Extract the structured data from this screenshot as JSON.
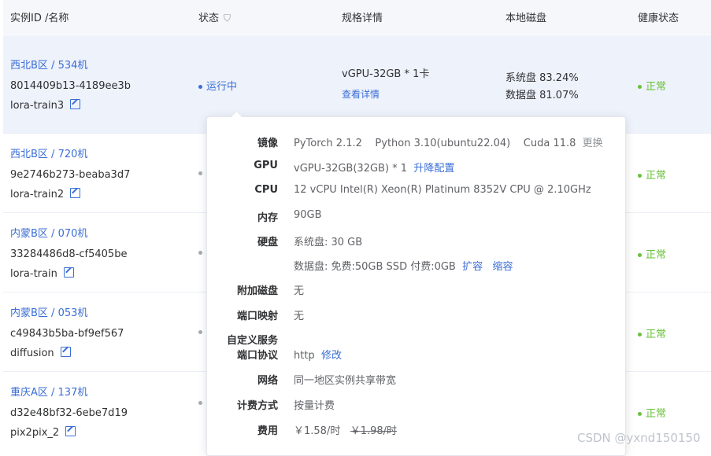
{
  "header": {
    "col_instance": "实例ID /名称",
    "col_status": "状态",
    "col_spec": "规格详情",
    "col_disk": "本地磁盘",
    "col_health": "健康状态"
  },
  "rows": [
    {
      "region": "西北B区 / 534机",
      "id": "8014409b13-4189ee3b",
      "name": "lora-train3",
      "status": "运行中",
      "spec": "vGPU-32GB * 1卡",
      "spec_link": "查看详情",
      "disk_sys": "系统盘 83.24%",
      "disk_data": "数据盘 81.07%",
      "health": "正常"
    },
    {
      "region": "西北B区 / 720机",
      "id": "9e2746b273-beaba3d7",
      "name": "lora-train2",
      "health": "正常"
    },
    {
      "region": "内蒙B区 / 070机",
      "id": "33284486d8-cf5405be",
      "name": "lora-train",
      "health": "正常"
    },
    {
      "region": "内蒙B区 / 053机",
      "id": "c49843b5ba-bf9ef567",
      "name": "diffusion",
      "health": "正常"
    },
    {
      "region": "重庆A区 / 137机",
      "id": "d32e48bf32-6ebe7d19",
      "name": "pix2pix_2",
      "health": "正常"
    }
  ],
  "popover": {
    "image_label": "镜像",
    "image_parts": {
      "pytorch": "PyTorch  2.1.2",
      "python": "Python  3.10(ubuntu22.04)",
      "cuda": "Cuda  11.8",
      "change": "更换"
    },
    "gpu_label": "GPU",
    "gpu_value": "vGPU-32GB(32GB) * 1",
    "gpu_link": "升降配置",
    "cpu_label": "CPU",
    "cpu_value": "12 vCPU Intel(R) Xeon(R) Platinum 8352V CPU @ 2.10GHz",
    "mem_label": "内存",
    "mem_value": "90GB",
    "disk_label": "硬盘",
    "disk_sys": "系统盘:  30 GB",
    "disk_data": "数据盘:  免费:50GB SSD  付费:0GB",
    "disk_expand": "扩容",
    "disk_shrink": "缩容",
    "extra_disk_label": "附加磁盘",
    "extra_disk_value": "无",
    "port_map_label": "端口映射",
    "port_map_value": "无",
    "custom_service_label": "自定义服务",
    "port_protocol_label": "端口协议",
    "port_protocol_value": "http",
    "port_protocol_link": "修改",
    "network_label": "网络",
    "network_value": "同一地区实例共享带宽",
    "billing_label": "计费方式",
    "billing_value": "按量计费",
    "fee_label": "费用",
    "fee_value": "￥1.58/时",
    "fee_original": "￥1.98/时"
  },
  "watermark": "CSDN @yxnd150150"
}
